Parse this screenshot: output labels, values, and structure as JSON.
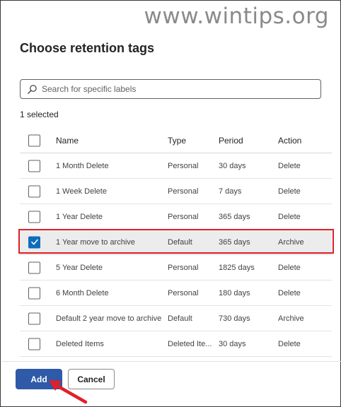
{
  "watermark": "www.wintips.org",
  "dialog": {
    "title": "Choose retention tags",
    "search_placeholder": "Search for specific labels",
    "selected_count": "1 selected"
  },
  "table": {
    "headers": {
      "name": "Name",
      "type": "Type",
      "period": "Period",
      "action": "Action"
    },
    "rows": [
      {
        "name": "1 Month Delete",
        "type": "Personal",
        "period": "30 days",
        "action": "Delete",
        "checked": false
      },
      {
        "name": "1 Week Delete",
        "type": "Personal",
        "period": "7 days",
        "action": "Delete",
        "checked": false
      },
      {
        "name": "1 Year Delete",
        "type": "Personal",
        "period": "365 days",
        "action": "Delete",
        "checked": false
      },
      {
        "name": "1 Year move to archive",
        "type": "Default",
        "period": "365 days",
        "action": "Archive",
        "checked": true
      },
      {
        "name": "5 Year Delete",
        "type": "Personal",
        "period": "1825 days",
        "action": "Delete",
        "checked": false
      },
      {
        "name": "6 Month Delete",
        "type": "Personal",
        "period": "180 days",
        "action": "Delete",
        "checked": false
      },
      {
        "name": "Default 2 year move to archive",
        "type": "Default",
        "period": "730 days",
        "action": "Archive",
        "checked": false
      },
      {
        "name": "Deleted Items",
        "type": "Deleted Ite...",
        "period": "30 days",
        "action": "Delete",
        "checked": false
      }
    ]
  },
  "footer": {
    "add_label": "Add",
    "cancel_label": "Cancel"
  },
  "colors": {
    "accent": "#0f6cbd",
    "primary_button": "#2e5aa8",
    "highlight": "#e0202a"
  },
  "icons": {
    "search": "search-icon",
    "check": "checkmark-icon",
    "annotation": "red-arrow-icon"
  }
}
